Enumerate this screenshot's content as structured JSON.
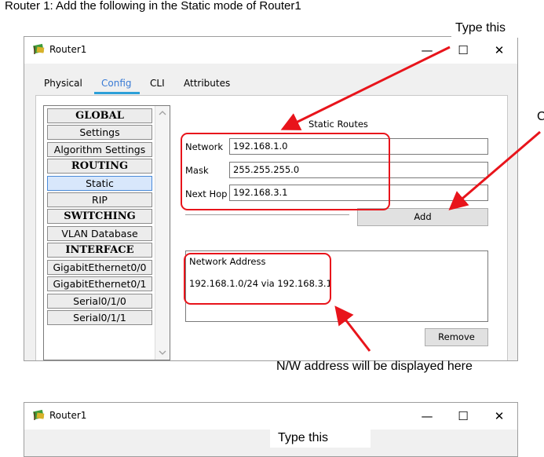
{
  "doc": {
    "heading": "Router 1: Add the following in the Static mode of Router1",
    "annot_type_this": "Type this",
    "annot_click": "C",
    "annot_nw": "N/W address will be displayed here"
  },
  "window1": {
    "title": "Router1",
    "controls": {
      "minimize": "—",
      "maximize": "☐",
      "close": "✕"
    },
    "tabs": [
      "Physical",
      "Config",
      "CLI",
      "Attributes"
    ],
    "sidebar": [
      "GLOBAL",
      "Settings",
      "Algorithm Settings",
      "ROUTING",
      "Static",
      "RIP",
      "SWITCHING",
      "VLAN Database",
      "INTERFACE",
      "GigabitEthernet0/0",
      "GigabitEthernet0/1",
      "Serial0/1/0",
      "Serial0/1/1"
    ],
    "section_title": "Static Routes",
    "form": {
      "network_label": "Network",
      "network_value": "192.168.1.0",
      "mask_label": "Mask",
      "mask_value": "255.255.255.0",
      "nexthop_label": "Next Hop",
      "nexthop_value": "192.168.3.1"
    },
    "add_button": "Add",
    "list_header": "Network Address",
    "list_items": [
      "192.168.1.0/24 via 192.168.3.1"
    ],
    "remove_button": "Remove"
  },
  "window2": {
    "title": "Router1",
    "controls": {
      "minimize": "—",
      "maximize": "☐",
      "close": "✕"
    },
    "annot_type_this": "Type this"
  },
  "colors": {
    "annotation_red": "#e8141b",
    "tab_accent": "#2da0d8",
    "selected_item": "#d8e7fb"
  }
}
